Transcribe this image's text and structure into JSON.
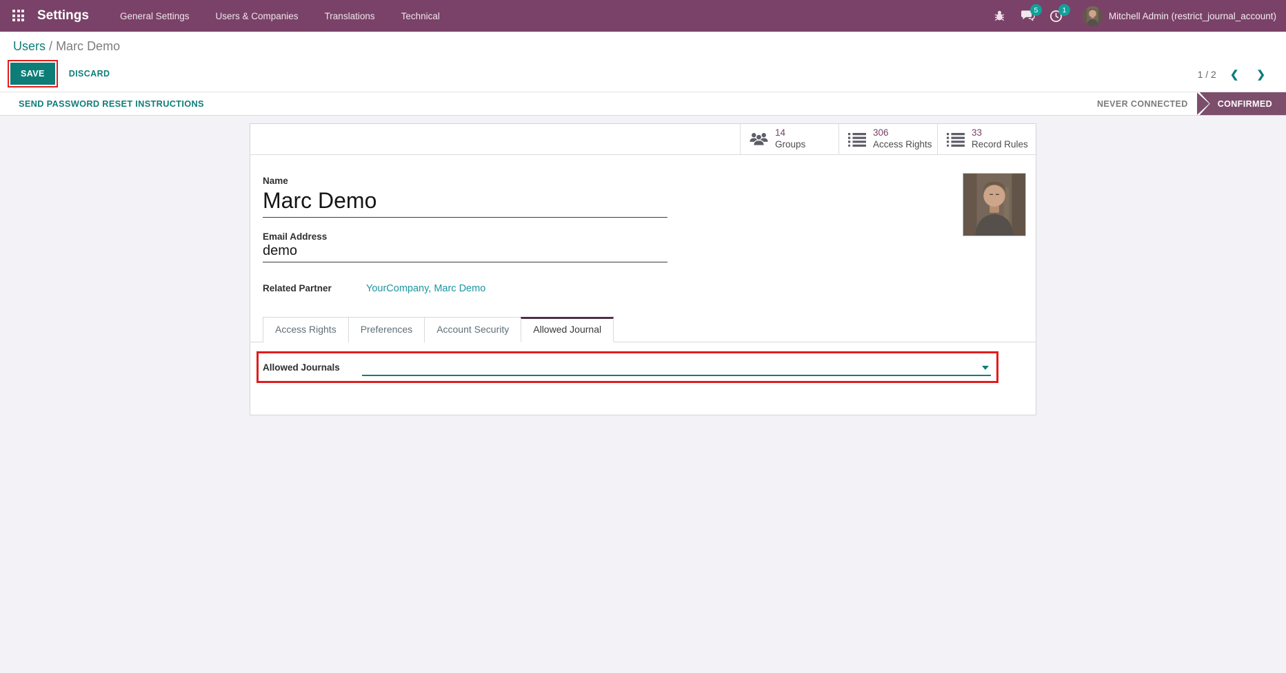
{
  "navbar": {
    "app_title": "Settings",
    "menu_items": {
      "general": "General Settings",
      "users": "Users & Companies",
      "translations": "Translations",
      "technical": "Technical"
    },
    "messages_badge": "5",
    "activities_badge": "1",
    "user_name": "Mitchell Admin (restrict_journal_account)"
  },
  "control_panel": {
    "breadcrumb_parent": "Users",
    "breadcrumb_separator": "/",
    "breadcrumb_current": "Marc Demo",
    "save_label": "SAVE",
    "discard_label": "DISCARD",
    "pager_value": "1 / 2",
    "prev_label": "❮",
    "next_label": "❯"
  },
  "status_bar": {
    "reset_password_label": "SEND PASSWORD RESET INSTRUCTIONS",
    "status_inactive": "NEVER CONNECTED",
    "status_active": "CONFIRMED"
  },
  "form": {
    "stat_buttons": [
      {
        "value": "14",
        "label": "Groups",
        "icon": "users-icon"
      },
      {
        "value": "306",
        "label": "Access Rights",
        "icon": "list-icon"
      },
      {
        "value": "33",
        "label": "Record Rules",
        "icon": "list-icon"
      }
    ],
    "fields": {
      "name_label": "Name",
      "name_value": "Marc Demo",
      "email_label": "Email Address",
      "email_value": "demo",
      "partner_label": "Related Partner",
      "partner_value": "YourCompany, Marc Demo",
      "allowed_journals_label": "Allowed Journals",
      "allowed_journals_value": ""
    },
    "tabs": [
      {
        "label": "Access Rights"
      },
      {
        "label": "Preferences"
      },
      {
        "label": "Account Security"
      },
      {
        "label": "Allowed Journal"
      }
    ]
  },
  "colors": {
    "navbar_bg": "#7a4268",
    "primary_teal": "#0e7d78",
    "link_teal": "#1a96a0",
    "badge_teal": "#12a09a",
    "stat_number": "#7a4168",
    "status_active_bg": "#7c4e6c",
    "annotation_red": "#e11c1c",
    "body_bg": "#f3f3f7"
  }
}
